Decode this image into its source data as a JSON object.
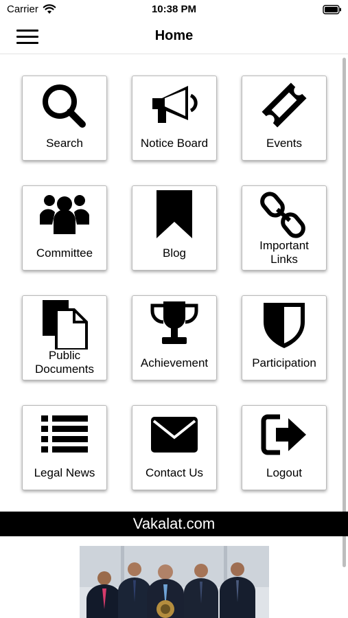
{
  "status": {
    "carrier": "Carrier",
    "time": "10:38 PM"
  },
  "header": {
    "title": "Home"
  },
  "menu": [
    {
      "label": "Search",
      "icon": "search-icon"
    },
    {
      "label": "Notice Board",
      "icon": "megaphone-icon"
    },
    {
      "label": "Events",
      "icon": "ticket-icon"
    },
    {
      "label": "Committee",
      "icon": "users-icon"
    },
    {
      "label": "Blog",
      "icon": "bookmark-icon"
    },
    {
      "label": "Important Links",
      "icon": "link-icon"
    },
    {
      "label": "Public Documents",
      "icon": "documents-icon"
    },
    {
      "label": "Achievement",
      "icon": "trophy-icon"
    },
    {
      "label": "Participation",
      "icon": "shield-icon"
    },
    {
      "label": "Legal News",
      "icon": "list-icon"
    },
    {
      "label": "Contact Us",
      "icon": "envelope-icon"
    },
    {
      "label": "Logout",
      "icon": "logout-icon"
    }
  ],
  "banner": {
    "text": "Vakalat.com"
  }
}
